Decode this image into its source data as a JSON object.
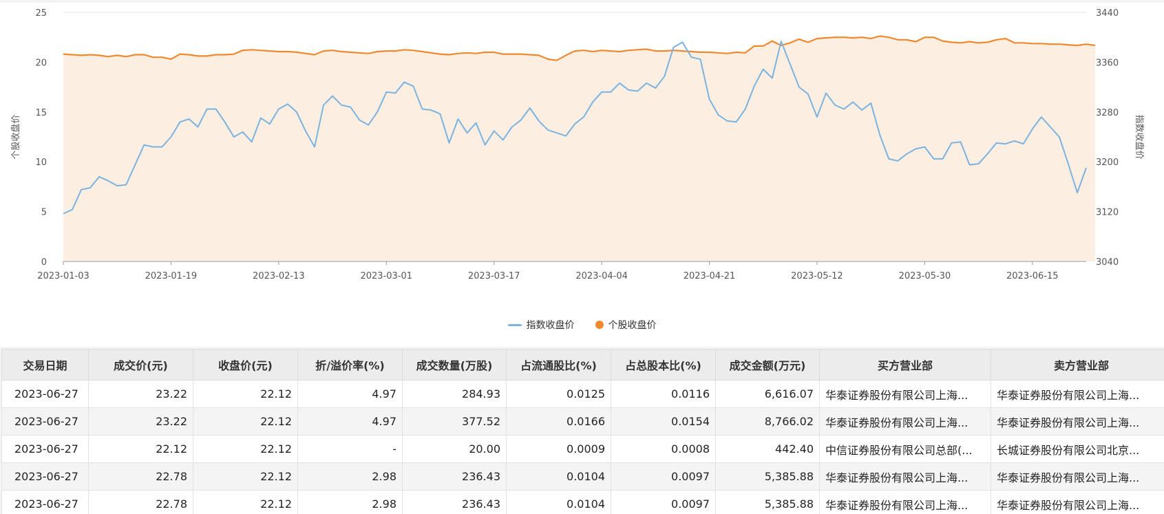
{
  "colors": {
    "index_line": "#7ab3e0",
    "stock_line": "#f0882e",
    "area_fill": "#fdeee2",
    "grid": "#e6e6e6"
  },
  "legend": {
    "index_label": "指数收盘价",
    "stock_label": "个股收盘价"
  },
  "chart_data": {
    "type": "line",
    "left_axis": {
      "label": "个股收盘价",
      "ticks": [
        "0",
        "5",
        "10",
        "15",
        "20",
        "25"
      ],
      "range": [
        0,
        25
      ]
    },
    "right_axis": {
      "label": "指数收盘价",
      "ticks": [
        "3040",
        "3120",
        "3200",
        "3280",
        "3360",
        "3440"
      ],
      "range": [
        3040,
        3440
      ]
    },
    "x_tick_labels": [
      "2023-01-03",
      "2023-01-19",
      "2023-02-13",
      "2023-03-01",
      "2023-03-17",
      "2023-04-04",
      "2023-04-21",
      "2023-05-12",
      "2023-05-30",
      "2023-06-15"
    ],
    "x_tick_positions": [
      0,
      12,
      24,
      36,
      48,
      60,
      72,
      84,
      96,
      108
    ],
    "grid": true,
    "legend_position": "bottom-center",
    "series": [
      {
        "name": "指数收盘价",
        "axis": "left",
        "values": [
          4.8,
          5.2,
          7.2,
          7.4,
          8.5,
          8.1,
          7.6,
          7.7,
          9.7,
          11.7,
          11.5,
          11.5,
          12.5,
          14.0,
          14.3,
          13.5,
          15.3,
          15.3,
          14.0,
          12.5,
          13.0,
          12.0,
          14.4,
          13.8,
          15.3,
          15.8,
          15.0,
          13.1,
          11.5,
          15.7,
          16.6,
          15.7,
          15.5,
          14.2,
          13.7,
          15.0,
          17.0,
          16.9,
          18.0,
          17.6,
          15.3,
          15.2,
          14.8,
          11.9,
          14.3,
          12.9,
          13.9,
          11.7,
          13.1,
          12.2,
          13.5,
          14.2,
          15.4,
          14.1,
          13.2,
          12.9,
          12.6,
          13.8,
          14.5,
          16.0,
          17.0,
          17.0,
          17.9,
          17.2,
          17.1,
          17.9,
          17.4,
          18.6,
          21.5,
          22.0,
          20.5,
          20.3,
          16.3,
          14.7,
          14.1,
          14.0,
          15.3,
          17.6,
          19.3,
          18.4,
          22.1,
          19.8,
          17.5,
          16.8,
          14.5,
          16.9,
          15.7,
          15.3,
          16.0,
          15.2,
          15.9,
          12.7,
          10.3,
          10.1,
          10.8,
          11.3,
          11.5,
          10.3,
          10.3,
          11.9,
          12.0,
          9.7,
          9.8,
          10.8,
          11.9,
          11.8,
          12.1,
          11.8,
          13.3,
          14.5,
          13.5,
          12.5,
          9.8,
          6.9,
          9.4
        ]
      },
      {
        "name": "个股收盘价",
        "axis": "right",
        "values": [
          3373,
          3372,
          3371,
          3372,
          3371,
          3369,
          3371,
          3369,
          3372,
          3372,
          3368,
          3368,
          3365,
          3373,
          3372,
          3370,
          3370,
          3372,
          3372,
          3373,
          3379,
          3380,
          3379,
          3378,
          3377,
          3377,
          3376,
          3374,
          3372,
          3378,
          3379,
          3377,
          3376,
          3375,
          3374,
          3377,
          3378,
          3378,
          3380,
          3379,
          3377,
          3375,
          3373,
          3372,
          3374,
          3375,
          3374,
          3376,
          3376,
          3373,
          3373,
          3373,
          3372,
          3371,
          3365,
          3363,
          3371,
          3378,
          3379,
          3377,
          3379,
          3378,
          3377,
          3379,
          3380,
          3381,
          3378,
          3378,
          3379,
          3378,
          3377,
          3376,
          3376,
          3375,
          3374,
          3376,
          3375,
          3386,
          3386,
          3394,
          3387,
          3391,
          3397,
          3392,
          3398,
          3399,
          3400,
          3400,
          3399,
          3400,
          3398,
          3402,
          3400,
          3396,
          3396,
          3393,
          3400,
          3400,
          3394,
          3392,
          3391,
          3393,
          3391,
          3392,
          3396,
          3398,
          3391,
          3391,
          3390,
          3390,
          3389,
          3389,
          3388,
          3387,
          3389,
          3387
        ]
      }
    ]
  },
  "table": {
    "headers": [
      "交易日期",
      "成交价(元)",
      "收盘价(元)",
      "折/溢价率(%)",
      "成交数量(万股)",
      "占流通股比(%)",
      "占总股本比(%)",
      "成交金额(万元)",
      "买方营业部",
      "卖方营业部"
    ],
    "rows": [
      [
        "2023-06-27",
        "23.22",
        "22.12",
        "4.97",
        "284.93",
        "0.0125",
        "0.0116",
        "6,616.07",
        "华泰证券股份有限公司上海...",
        "华泰证券股份有限公司上海..."
      ],
      [
        "2023-06-27",
        "23.22",
        "22.12",
        "4.97",
        "377.52",
        "0.0166",
        "0.0154",
        "8,766.02",
        "华泰证券股份有限公司上海...",
        "华泰证券股份有限公司上海..."
      ],
      [
        "2023-06-27",
        "22.12",
        "22.12",
        "-",
        "20.00",
        "0.0009",
        "0.0008",
        "442.40",
        "中信证券股份有限公司总部(...",
        "长城证券股份有限公司北京..."
      ],
      [
        "2023-06-27",
        "22.78",
        "22.12",
        "2.98",
        "236.43",
        "0.0104",
        "0.0097",
        "5,385.88",
        "华泰证券股份有限公司上海...",
        "华泰证券股份有限公司上海..."
      ],
      [
        "2023-06-27",
        "22.78",
        "22.12",
        "2.98",
        "236.43",
        "0.0104",
        "0.0097",
        "5,385.88",
        "华泰证券股份有限公司上海...",
        "华泰证券股份有限公司上海..."
      ]
    ]
  }
}
